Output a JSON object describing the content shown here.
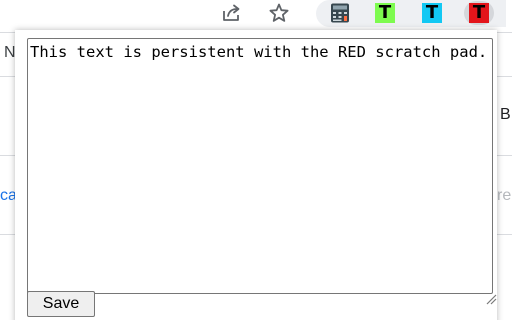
{
  "toolbar": {
    "share_icon": "share-icon",
    "star_icon": "star-icon",
    "extensions": [
      {
        "name": "calculator-extension",
        "icon": "calculator-icon"
      },
      {
        "name": "green-scratch-pad",
        "letter": "T",
        "color": "#7dfb4f"
      },
      {
        "name": "cyan-scratch-pad",
        "letter": "T",
        "color": "#12c8f3"
      },
      {
        "name": "red-scratch-pad",
        "letter": "T",
        "color": "#e3151b"
      }
    ]
  },
  "background": {
    "frag_n": "N",
    "frag_ca": "ca",
    "frag_b": "B",
    "frag_re": "re"
  },
  "popup": {
    "text": "This text is persistent with the RED scratch pad.",
    "save_label": "Save"
  },
  "colors": {
    "green": "#7dfb4f",
    "cyan": "#12c8f3",
    "red": "#e3151b",
    "link_blue": "#1a73e8"
  }
}
